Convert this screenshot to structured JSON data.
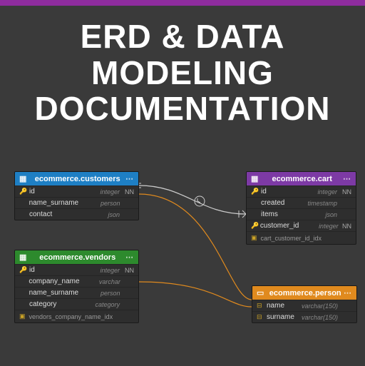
{
  "title_lines": [
    "ERD & DATA",
    "MODELING",
    "DOCUMENTATION"
  ],
  "entities": {
    "customers": {
      "header": "ecommerce.customers",
      "color": "blue",
      "fields": [
        {
          "key": "🔑",
          "name": "id",
          "type": "integer",
          "nn": "NN"
        },
        {
          "key": "",
          "name": "name_surname",
          "type": "person",
          "nn": ""
        },
        {
          "key": "",
          "name": "contact",
          "type": "json",
          "nn": ""
        }
      ],
      "index": null
    },
    "vendors": {
      "header": "ecommerce.vendors",
      "color": "green",
      "fields": [
        {
          "key": "🔑",
          "name": "id",
          "type": "integer",
          "nn": "NN"
        },
        {
          "key": "",
          "name": "company_name",
          "type": "varchar",
          "nn": ""
        },
        {
          "key": "",
          "name": "name_surname",
          "type": "person",
          "nn": ""
        },
        {
          "key": "",
          "name": "category",
          "type": "category",
          "nn": ""
        }
      ],
      "index": "vendors_company_name_idx"
    },
    "cart": {
      "header": "ecommerce.cart",
      "color": "purple",
      "fields": [
        {
          "key": "🔑",
          "name": "id",
          "type": "integer",
          "nn": "NN"
        },
        {
          "key": "",
          "name": "created",
          "type": "timestamp",
          "nn": ""
        },
        {
          "key": "",
          "name": "items",
          "type": "json",
          "nn": ""
        },
        {
          "key": "🔑",
          "name": "customer_id",
          "type": "integer",
          "nn": "NN"
        }
      ],
      "index": "cart_customer_id_idx"
    },
    "person": {
      "header": "ecommerce.person",
      "color": "orange",
      "fields": [
        {
          "key": "⊟",
          "name": "name",
          "type": "varchar(150)",
          "nn": ""
        },
        {
          "key": "⊟",
          "name": "surname",
          "type": "varchar(150)",
          "nn": ""
        }
      ],
      "index": null
    }
  }
}
